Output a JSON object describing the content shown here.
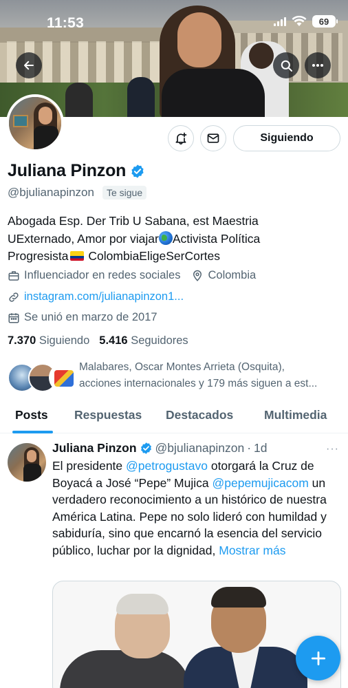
{
  "status_bar": {
    "time": "11:53",
    "battery": "69"
  },
  "colors": {
    "accent": "#1d9bf0",
    "text": "#0f1419",
    "secondary": "#536471",
    "border": "#cfd9de"
  },
  "header": {
    "back_icon": "arrow-left-icon",
    "search_icon": "search-icon",
    "more_icon": "more-horizontal-icon"
  },
  "profile": {
    "name": "Juliana Pinzon",
    "handle": "@bjulianapinzon",
    "follows_you_badge": "Te sigue",
    "follow_button": "Siguiendo",
    "bio_line1": "Abogada Esp. Der Trib U Sabana, est Maestria",
    "bio_line2_a": "UExternado, Amor por viajar",
    "bio_line2_b": "Activista Política",
    "bio_line3_a": "Progresista",
    "bio_line3_b": " ColombiaEligeSerCortes",
    "category": "Influenciador en redes sociales",
    "location": "Colombia",
    "website": "instagram.com/julianapinzon1...",
    "joined": "Se unió en marzo de 2017",
    "following_count": "7.370",
    "following_label": "Siguiendo",
    "followers_count": "5.416",
    "followers_label": "Seguidores",
    "followers_you_know_line1": "Malabares, Oscar Montes Arrieta (Osquita),",
    "followers_you_know_line2": "acciones internacionales y 179 más siguen a est..."
  },
  "tabs": [
    {
      "label": "Posts",
      "active": true
    },
    {
      "label": "Respuestas",
      "active": false
    },
    {
      "label": "Destacados",
      "active": false
    },
    {
      "label": "Multimedia",
      "active": false
    }
  ],
  "tweet": {
    "name": "Juliana Pinzon",
    "handle": "@bjulianapinzon",
    "separator": "·",
    "time": "1d",
    "more": "···",
    "text_1": "El presidente ",
    "mention_1": "@petrogustavo",
    "text_2": " otorgará la Cruz de Boyacá a José “Pepe” Mujica ",
    "mention_2": "@pepemujicacom",
    "text_3": " un verdadero reconocimiento a un histórico de nuestra América Latina. Pepe no solo lideró con humildad y sabiduría, sino que encarnó la esencia del servicio público, luchar por la dignidad, ",
    "show_more": "Mostrar más"
  },
  "fab": {
    "icon": "plus-icon"
  }
}
